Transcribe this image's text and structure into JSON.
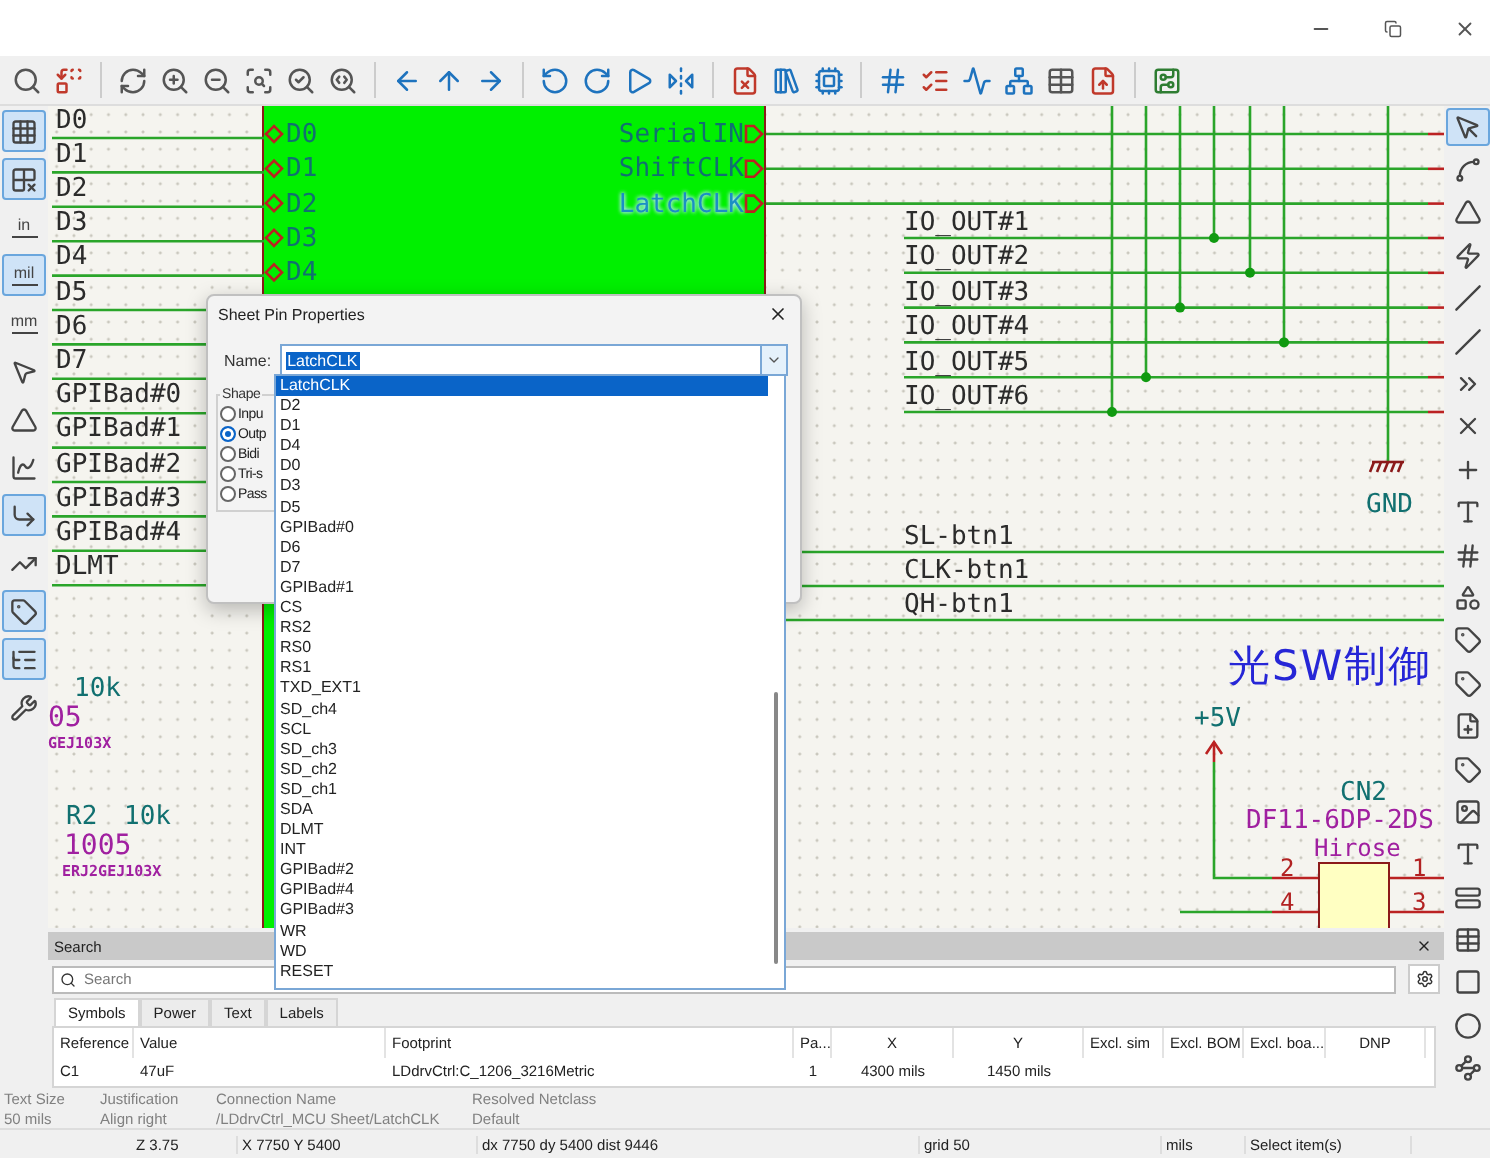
{
  "toolbar_left": [
    {
      "selected": true
    },
    {
      "selected": true
    },
    {
      "label": "in",
      "selected": false
    },
    {
      "label": "mil",
      "selected": true
    },
    {
      "label": "mm",
      "selected": false
    },
    {
      "selected": false
    },
    {
      "selected": false
    },
    {
      "selected": false
    },
    {
      "selected": true
    },
    {
      "selected": false
    },
    {
      "selected": true
    },
    {
      "selected": true
    },
    {
      "selected": false
    }
  ],
  "toolbar_right": [
    {
      "selected": true
    },
    {
      "selected": false
    },
    {
      "selected": false
    },
    {
      "selected": false
    },
    {
      "selected": false
    },
    {
      "selected": false
    },
    {
      "selected": false
    },
    {
      "selected": false
    },
    {
      "selected": false
    },
    {
      "selected": false
    },
    {
      "selected": false
    },
    {
      "selected": false
    },
    {
      "selected": false
    },
    {
      "selected": false
    },
    {
      "selected": false
    },
    {
      "selected": false
    },
    {
      "selected": false
    },
    {
      "selected": false
    },
    {
      "selected": false
    },
    {
      "selected": false
    },
    {
      "selected": false
    },
    {
      "selected": false
    },
    {
      "selected": false
    }
  ],
  "schematic": {
    "left_labels": [
      "D0",
      "D1",
      "D2",
      "D3",
      "D4",
      "D5",
      "D6",
      "D7",
      "GPIBad#0",
      "GPIBad#1",
      "GPIBad#2",
      "GPIBad#3",
      "GPIBad#4",
      "DLMT"
    ],
    "sheet": {
      "left_pins": [
        "D0",
        "D1",
        "D2",
        "D3",
        "D4"
      ],
      "right_pins": [
        {
          "name": "SerialIN",
          "selected": false
        },
        {
          "name": "ShiftCLK",
          "selected": false
        },
        {
          "name": "LatchCLK",
          "selected": true
        }
      ]
    },
    "output_labels": [
      "IO_OUT#1",
      "IO_OUT#2",
      "IO_OUT#3",
      "IO_OUT#4",
      "IO_OUT#5",
      "IO_OUT#6"
    ],
    "button_labels": [
      "SL-btn1",
      "CLK-btn1",
      "QH-btn1"
    ],
    "gnd": "GND",
    "vcc": "+5V",
    "heading": "光SW制御",
    "connector": {
      "reference": "CN2",
      "value": "DF11-6DP-2DS",
      "manufacturer": "Hirose",
      "pins": [
        "2",
        "4",
        "1",
        "3"
      ]
    },
    "resistors": [
      {
        "value": "10k",
        "footprint": "05",
        "part": "GEJ103X"
      },
      {
        "reference": "R2",
        "value": "10k",
        "footprint": "1005",
        "part": "ERJ2GEJ103X"
      }
    ]
  },
  "dialog": {
    "title": "Sheet Pin Properties",
    "name_label": "Name:",
    "name_value": "LatchCLK",
    "shape_label": "Shape",
    "shape_options": [
      {
        "label": "Inpu",
        "selected": false
      },
      {
        "label": "Outp",
        "selected": true
      },
      {
        "label": "Bidi",
        "selected": false
      },
      {
        "label": "Tri-s",
        "selected": false
      },
      {
        "label": "Pass",
        "selected": false
      }
    ],
    "dropdown_items": [
      {
        "label": "LatchCLK",
        "selected": true
      },
      {
        "label": "D2",
        "selected": false
      },
      {
        "label": "D1",
        "selected": false
      },
      {
        "label": "D4",
        "selected": false
      },
      {
        "label": "D0",
        "selected": false
      },
      {
        "label": "D3",
        "selected": false
      },
      {
        "label": "D5",
        "selected": false
      },
      {
        "label": "GPIBad#0",
        "selected": false
      },
      {
        "label": "D6",
        "selected": false
      },
      {
        "label": "D7",
        "selected": false
      },
      {
        "label": "GPIBad#1",
        "selected": false
      },
      {
        "label": "CS",
        "selected": false
      },
      {
        "label": "RS2",
        "selected": false
      },
      {
        "label": "RS0",
        "selected": false
      },
      {
        "label": "RS1",
        "selected": false
      },
      {
        "label": "TXD_EXT1",
        "selected": false
      },
      {
        "label": "SD_ch4",
        "selected": false
      },
      {
        "label": "SCL",
        "selected": false
      },
      {
        "label": "SD_ch3",
        "selected": false
      },
      {
        "label": "SD_ch2",
        "selected": false
      },
      {
        "label": "SD_ch1",
        "selected": false
      },
      {
        "label": "SDA",
        "selected": false
      },
      {
        "label": "DLMT",
        "selected": false
      },
      {
        "label": "INT",
        "selected": false
      },
      {
        "label": "GPIBad#2",
        "selected": false
      },
      {
        "label": "GPIBad#4",
        "selected": false
      },
      {
        "label": "GPIBad#3",
        "selected": false
      },
      {
        "label": "WR",
        "selected": false
      },
      {
        "label": "WD",
        "selected": false
      },
      {
        "label": "RESET",
        "selected": false
      }
    ]
  },
  "search_panel": {
    "title": "Search",
    "placeholder": "Search",
    "tabs": [
      {
        "label": "Symbols",
        "selected": true
      },
      {
        "label": "Power",
        "selected": false
      },
      {
        "label": "Text",
        "selected": false
      },
      {
        "label": "Labels",
        "selected": false
      }
    ],
    "columns": [
      "Reference",
      "Value",
      "Footprint",
      "Pa...",
      "X",
      "Y",
      "Excl. sim",
      "Excl. BOM",
      "Excl. boa...",
      "DNP"
    ],
    "rows": [
      [
        "C1",
        "47uF",
        "LDdrvCtrl:C_1206_3216Metric",
        "1",
        "4300 mils",
        "1450 mils"
      ]
    ]
  },
  "properties": [
    {
      "label": "Text Size",
      "value": "50 mils"
    },
    {
      "label": "Justification",
      "value": "Align right"
    },
    {
      "label": "Connection Name",
      "value": "/LDdrvCtrl_MCU Sheet/LatchCLK"
    },
    {
      "label": "Resolved Netclass",
      "value": "Default"
    }
  ],
  "status_bar": [
    "Z 3.75",
    "X 7750 Y 5400",
    "dx 7750 dy 5400 dist 9446",
    "grid 50",
    "mils",
    "Select item(s)"
  ]
}
